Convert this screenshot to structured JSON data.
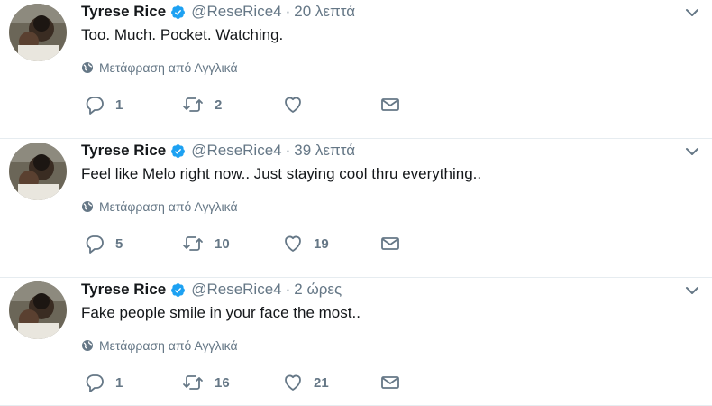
{
  "tweets": [
    {
      "name": "Tyrese Rice",
      "handle": "@ReseRice4",
      "time": "20 λεπτά",
      "text": "Too. Much. Pocket. Watching.",
      "translate": "Μετάφραση από Αγγλικά",
      "replies": "1",
      "retweets": "2",
      "likes": ""
    },
    {
      "name": "Tyrese Rice",
      "handle": "@ReseRice4",
      "time": "39 λεπτά",
      "text": "Feel like Melo right now.. Just staying cool thru everything..",
      "translate": "Μετάφραση από Αγγλικά",
      "replies": "5",
      "retweets": "10",
      "likes": "19"
    },
    {
      "name": "Tyrese Rice",
      "handle": "@ReseRice4",
      "time": "2 ώρες",
      "text": "Fake people smile in your face the most..",
      "translate": "Μετάφραση από Αγγλικά",
      "replies": "1",
      "retweets": "16",
      "likes": "21"
    }
  ],
  "icons": {
    "verified": "verified-badge-icon",
    "caret": "chevron-down-icon",
    "globe": "globe-icon",
    "reply": "reply-icon",
    "retweet": "retweet-icon",
    "like": "heart-icon",
    "dm": "envelope-icon"
  },
  "colors": {
    "verified": "#1da1f2",
    "muted": "#657786",
    "text": "#14171a",
    "divider": "#e6ecf0"
  }
}
